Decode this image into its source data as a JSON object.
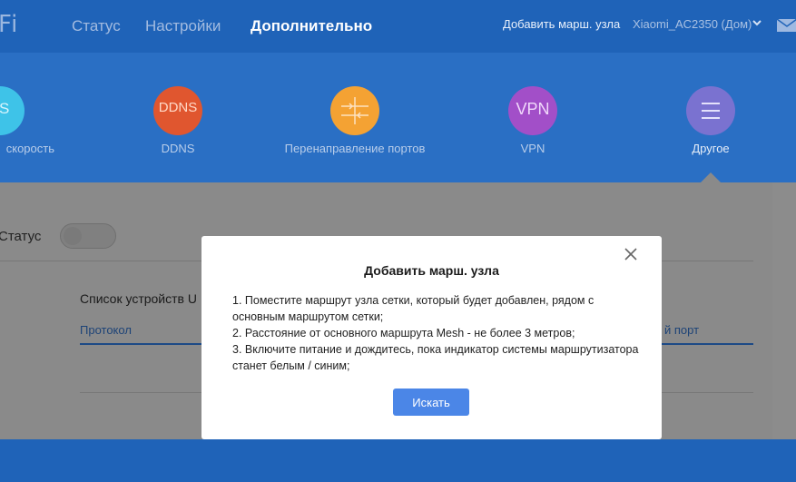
{
  "header": {
    "logo": "Fi",
    "nav": [
      "Статус",
      "Настройки",
      "Дополнительно"
    ],
    "add_node": "Добавить марш. узла",
    "router_name": "Xiaomi_AC2350 (Дом)"
  },
  "features": [
    {
      "icon_text": "oS",
      "label": "скорость"
    },
    {
      "icon_text": "DDNS",
      "label": "DDNS"
    },
    {
      "icon_text": "",
      "label": "Перенаправление портов"
    },
    {
      "icon_text": "VPN",
      "label": "VPN"
    },
    {
      "icon_text": "",
      "label": "Другое"
    }
  ],
  "colors": {
    "header_bg": "#1f63b8",
    "band_bg": "#2a6fc4",
    "ddns": "#e0562f",
    "port_forward": "#f4a233",
    "vpn": "#a24fc8",
    "other": "#7a72d0",
    "qos": "#3ec3e8",
    "button": "#4b86e7"
  },
  "content": {
    "status_label": "Статус",
    "device_list_title": "Список устройств U",
    "col_protocol": "Протокол",
    "col_port": "й порт"
  },
  "modal": {
    "title": "Добавить марш. узла",
    "lines": [
      "1. Поместите маршрут узла сетки, который будет добавлен, рядом с основным маршрутом сетки;",
      "2. Расстояние от основного маршрута Mesh - не более 3 метров;",
      "3. Включите питание и дождитесь, пока индикатор системы маршрутизатора станет белым / синим;"
    ],
    "button": "Искать"
  }
}
